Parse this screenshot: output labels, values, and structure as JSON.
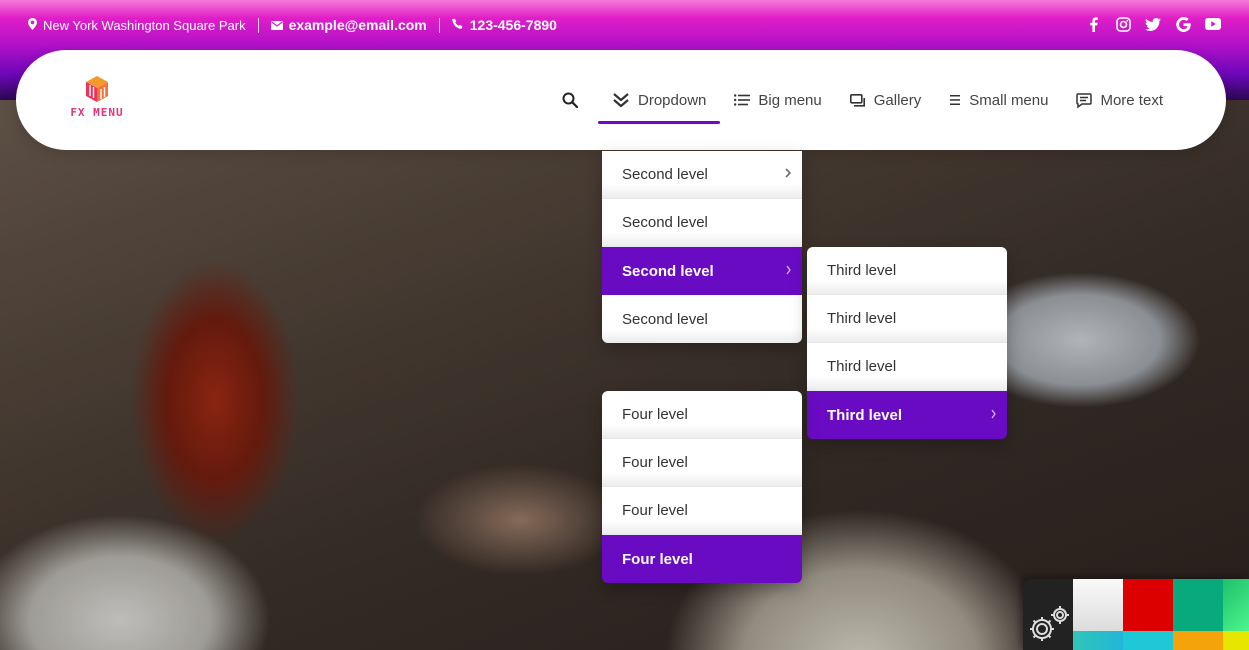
{
  "topbar": {
    "address": "New York Washington Square Park",
    "email": "example@email.com",
    "phone": "123-456-7890",
    "social": [
      "facebook-icon",
      "instagram-icon",
      "twitter-icon",
      "google-icon",
      "youtube-icon"
    ]
  },
  "logo": {
    "text": "FX MENU"
  },
  "nav": {
    "items": [
      {
        "label": "Dropdown",
        "icon": "double-chevron-down-icon",
        "active": true
      },
      {
        "label": "Big menu",
        "icon": "list-icon"
      },
      {
        "label": "Gallery",
        "icon": "gallery-icon"
      },
      {
        "label": "Small menu",
        "icon": "menu-lines-icon"
      },
      {
        "label": "More text",
        "icon": "chat-icon"
      }
    ]
  },
  "dropdown": {
    "second_level": [
      {
        "label": "Second level",
        "has_submenu": true
      },
      {
        "label": "Second level"
      },
      {
        "label": "Second level",
        "active": true,
        "has_submenu": true
      },
      {
        "label": "Second level"
      }
    ],
    "third_level": [
      {
        "label": "Third level"
      },
      {
        "label": "Third level"
      },
      {
        "label": "Third level"
      },
      {
        "label": "Third level",
        "active": true,
        "has_submenu": true
      }
    ],
    "four_level": [
      {
        "label": "Four level"
      },
      {
        "label": "Four level"
      },
      {
        "label": "Four level"
      },
      {
        "label": "Four level",
        "active": true
      }
    ]
  },
  "colors": {
    "accent": "#6a0bc4",
    "swatches": [
      "#e8e8e8",
      "#dd0000",
      "#08a97a",
      "#2ee07a",
      "#1ec8d6",
      "#1ec8d6",
      "#f5a30a",
      "#e6e600"
    ]
  }
}
